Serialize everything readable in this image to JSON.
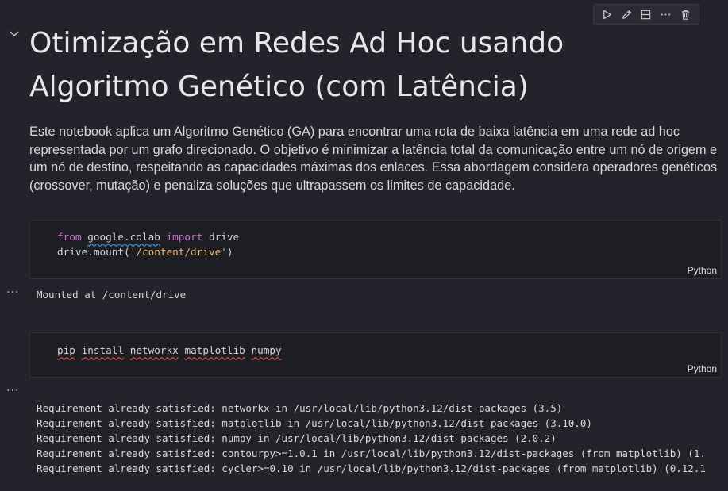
{
  "toolbar": {
    "items": [
      {
        "name": "run-cell-button",
        "icon": "play-icon"
      },
      {
        "name": "edit-cell-button",
        "icon": "pencil-icon"
      },
      {
        "name": "split-cell-button",
        "icon": "split-icon"
      },
      {
        "name": "more-actions-button",
        "icon": "more-icon"
      },
      {
        "name": "delete-cell-button",
        "icon": "trash-icon"
      }
    ]
  },
  "markdown": {
    "title": "Otimização em Redes Ad Hoc usando Algoritmo Genético (com Latência)",
    "description": "Este notebook aplica um Algoritmo Genético (GA) para encontrar uma rota de baixa latência em uma rede ad hoc representada por um grafo direcionado. O objetivo é minimizar a latência total da comunicação entre um nó de origem e um nó de destino, respeitando as capacidades máximas dos enlaces. Essa abordagem considera operadores genéticos (crossover, mutação) e penaliza soluções que ultrapassem os limites de capacidade."
  },
  "cell1": {
    "kw_from": "from",
    "module": "google.colab",
    "kw_import": "import",
    "name": " drive",
    "call": "drive.mount(",
    "path": "'/content/drive'",
    "close": ")",
    "language": "Python",
    "output": "Mounted at /content/drive"
  },
  "cell2": {
    "pip": "pip",
    "install": "install",
    "pkg1": "networkx",
    "pkg2": "matplotlib",
    "pkg3": "numpy",
    "language": "Python",
    "output_lines": [
      "Requirement already satisfied: networkx in /usr/local/lib/python3.12/dist-packages (3.5)",
      "Requirement already satisfied: matplotlib in /usr/local/lib/python3.12/dist-packages (3.10.0)",
      "Requirement already satisfied: numpy in /usr/local/lib/python3.12/dist-packages (2.0.2)",
      "Requirement already satisfied: contourpy>=1.0.1 in /usr/local/lib/python3.12/dist-packages (from matplotlib) (1.",
      "Requirement already satisfied: cycler>=0.10 in /usr/local/lib/python3.12/dist-packages (from matplotlib) (0.12.1"
    ]
  },
  "ellipsis": "···",
  "colors": {
    "background": "#23242b",
    "cell_background": "#1d1e23",
    "keyword": "#d16fd0",
    "string": "#e8b66c"
  }
}
